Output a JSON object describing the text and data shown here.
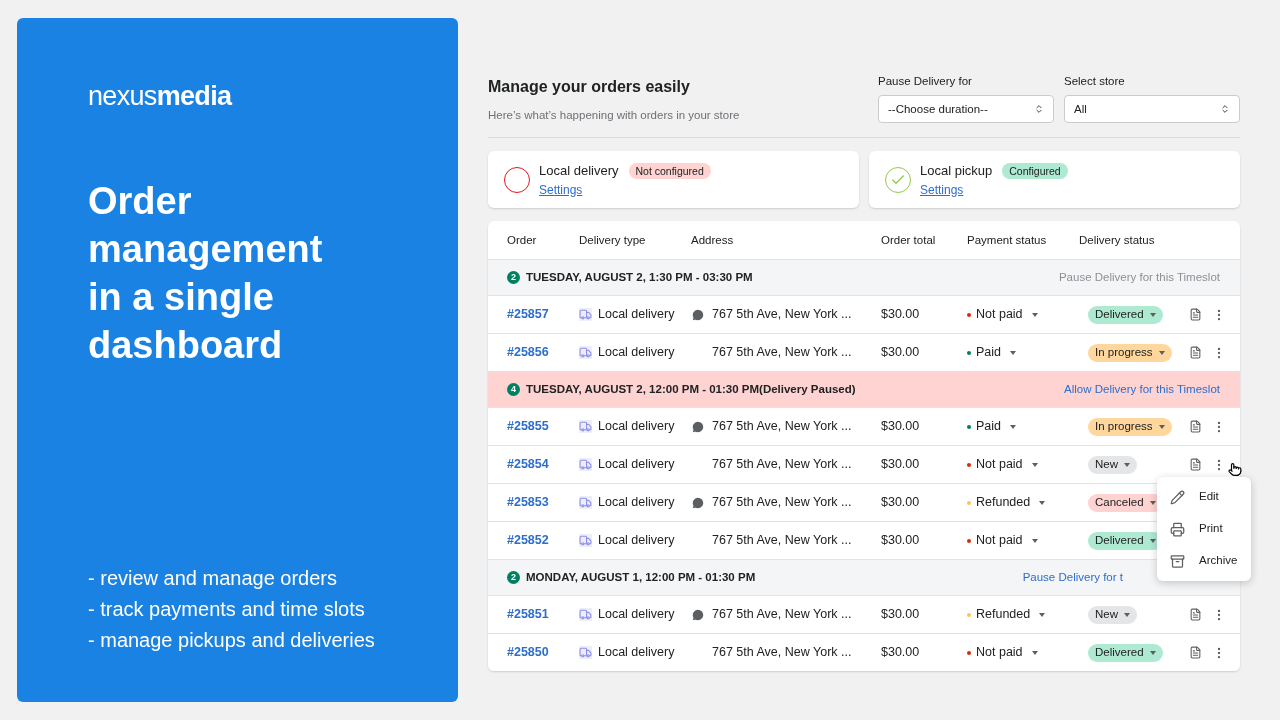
{
  "brand": {
    "logo": "nexus**media**",
    "headline": [
      "Order",
      "management",
      "in a single",
      "dashboard"
    ],
    "features": [
      "- review and manage orders",
      "- track payments and time slots",
      "- manage pickups and deliveries"
    ]
  },
  "header": {
    "title": "Manage your orders easily",
    "subtitle": "Here’s what’s happening with orders in your store",
    "filters": [
      {
        "label": "Pause Delivery for",
        "value": "--Choose duration--"
      },
      {
        "label": "Select store",
        "value": "All"
      }
    ]
  },
  "methods": [
    {
      "name": "Local delivery",
      "badge": "Not configured",
      "configured": false,
      "link": "Settings"
    },
    {
      "name": "Local pickup",
      "badge": "Configured",
      "configured": true,
      "link": "Settings"
    }
  ],
  "table": {
    "columns": [
      "Order",
      "Delivery type",
      "Address",
      "Order total",
      "Payment status",
      "Delivery status"
    ],
    "groups": [
      {
        "count": "2",
        "title": "TUESDAY, AUGUST 2, 1:30 PM - 03:30 PM",
        "action": "Pause Delivery for this Timeslot",
        "paused": false,
        "rows": [
          {
            "order": "#25857",
            "type": "Local delivery",
            "note": true,
            "address": "767 5th Ave, New York ...",
            "total": "$30.00",
            "payment": {
              "label": "Not paid",
              "color": "#d72c0d"
            },
            "status": {
              "label": "Delivered",
              "color": "#aee9d1"
            }
          },
          {
            "order": "#25856",
            "type": "Local delivery",
            "note": false,
            "address": "767 5th Ave, New York ...",
            "total": "$30.00",
            "payment": {
              "label": "Paid",
              "color": "#007f5f"
            },
            "status": {
              "label": "In progress",
              "color": "#ffd79d"
            }
          }
        ]
      },
      {
        "count": "4",
        "title": "TUESDAY, AUGUST 2, 12:00 PM - 01:30 PM(Delivery Paused)",
        "action": "Allow Delivery for this Timeslot",
        "paused": true,
        "rows": [
          {
            "order": "#25855",
            "type": "Local delivery",
            "note": true,
            "address": "767 5th Ave, New York ...",
            "total": "$30.00",
            "payment": {
              "label": "Paid",
              "color": "#007f5f"
            },
            "status": {
              "label": "In progress",
              "color": "#ffd79d"
            }
          },
          {
            "order": "#25854",
            "type": "Local delivery",
            "note": false,
            "address": "767 5th Ave, New York ...",
            "total": "$30.00",
            "payment": {
              "label": "Not paid",
              "color": "#d72c0d"
            },
            "status": {
              "label": "New",
              "color": "#e4e5e7"
            }
          },
          {
            "order": "#25853",
            "type": "Local delivery",
            "note": true,
            "address": "767 5th Ave, New York ...",
            "total": "$30.00",
            "payment": {
              "label": "Refunded",
              "color": "#ffc453"
            },
            "status": {
              "label": "Canceled",
              "color": "#fed3d1"
            },
            "actions_visible": false
          },
          {
            "order": "#25852",
            "type": "Local delivery",
            "note": false,
            "address": "767 5th Ave, New York ...",
            "total": "$30.00",
            "payment": {
              "label": "Not paid",
              "color": "#d72c0d"
            },
            "status": {
              "label": "Delivered",
              "color": "#aee9d1"
            },
            "actions_visible": false
          }
        ]
      },
      {
        "count": "2",
        "title": "MONDAY, AUGUST 1, 12:00 PM - 01:30 PM",
        "action": "Pause Delivery for t",
        "paused": false,
        "rows": [
          {
            "order": "#25851",
            "type": "Local delivery",
            "note": true,
            "address": "767 5th Ave, New York ...",
            "total": "$30.00",
            "payment": {
              "label": "Refunded",
              "color": "#ffc453"
            },
            "status": {
              "label": "New",
              "color": "#e4e5e7"
            }
          },
          {
            "order": "#25850",
            "type": "Local delivery",
            "note": false,
            "address": "767 5th Ave, New York ...",
            "total": "$30.00",
            "payment": {
              "label": "Not paid",
              "color": "#d72c0d"
            },
            "status": {
              "label": "Delivered",
              "color": "#aee9d1"
            }
          }
        ]
      }
    ]
  },
  "menu": {
    "items": [
      {
        "kind": "edit",
        "label": "Edit"
      },
      {
        "kind": "print",
        "label": "Print"
      },
      {
        "kind": "archive",
        "label": "Archive"
      }
    ]
  }
}
